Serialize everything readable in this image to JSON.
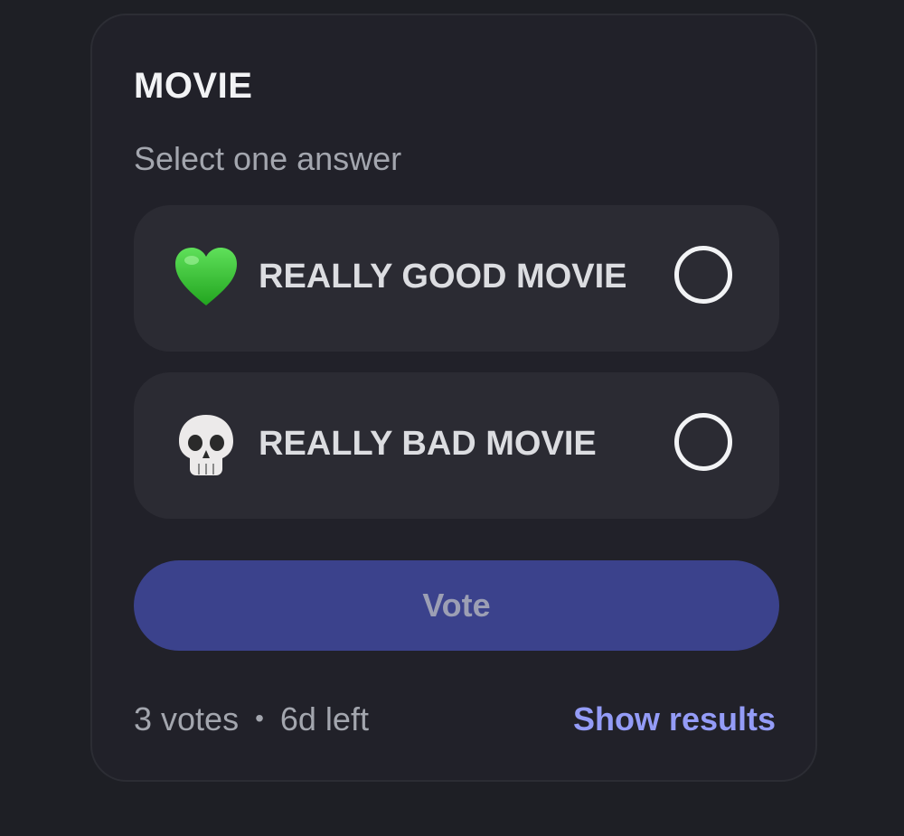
{
  "poll": {
    "title": "MOVIE",
    "instruction": "Select one answer",
    "answers": [
      {
        "emoji_icon": "green-heart-icon",
        "label": "REALLY GOOD MOVIE",
        "selected": false
      },
      {
        "emoji_icon": "skull-icon",
        "label": "REALLY BAD MOVIE",
        "selected": false
      }
    ],
    "vote_label": "Vote",
    "votes": "3 votes",
    "separator": "•",
    "time_left": "6d left",
    "show_results_label": "Show results"
  },
  "colors": {
    "background": "#1e1f25",
    "card": "#212129",
    "answer_bg": "#2b2b33",
    "vote_button": "#3b428c",
    "link": "#949cf7",
    "heart_green": "#3dc43a"
  }
}
